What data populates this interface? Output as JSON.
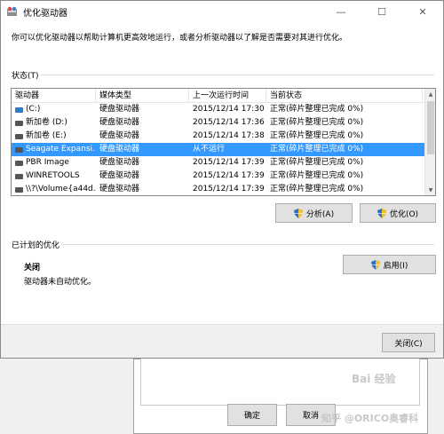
{
  "window": {
    "title": "优化驱动器",
    "controls": {
      "minimize": "—",
      "maximize": "☐",
      "close": "✕"
    }
  },
  "description": "你可以优化驱动器以帮助计算机更高效地运行，或者分析驱动器以了解是否需要对其进行优化。",
  "status_section": {
    "label": "状态(T)",
    "columns": [
      "驱动器",
      "媒体类型",
      "上一次运行时间",
      "当前状态"
    ],
    "rows": [
      {
        "drive": "(C:)",
        "media": "硬盘驱动器",
        "last_run": "2015/12/14 17:30",
        "status": "正常(碎片整理已完成 0%)",
        "icon": "system-drive-icon",
        "selected": false
      },
      {
        "drive": "新加卷 (D:)",
        "media": "硬盘驱动器",
        "last_run": "2015/12/14 17:36",
        "status": "正常(碎片整理已完成 0%)",
        "icon": "drive-icon",
        "selected": false
      },
      {
        "drive": "新加卷 (E:)",
        "media": "硬盘驱动器",
        "last_run": "2015/12/14 17:38",
        "status": "正常(碎片整理已完成 0%)",
        "icon": "drive-icon",
        "selected": false
      },
      {
        "drive": "Seagate Expansi...",
        "media": "硬盘驱动器",
        "last_run": "从不运行",
        "status": "正常(碎片整理已完成 0%)",
        "icon": "drive-icon",
        "selected": true
      },
      {
        "drive": "PBR Image",
        "media": "硬盘驱动器",
        "last_run": "2015/12/14 17:39",
        "status": "正常(碎片整理已完成 0%)",
        "icon": "drive-icon",
        "selected": false
      },
      {
        "drive": "WINRETOOLS",
        "media": "硬盘驱动器",
        "last_run": "2015/12/14 17:39",
        "status": "正常(碎片整理已完成 0%)",
        "icon": "drive-icon",
        "selected": false
      },
      {
        "drive": "\\\\?\\Volume{a44d...",
        "media": "硬盘驱动器",
        "last_run": "2015/12/14 17:39",
        "status": "正常(碎片整理已完成 0%)",
        "icon": "drive-icon",
        "selected": false
      }
    ],
    "analyze_button": "分析(A)",
    "optimize_button": "优化(O)"
  },
  "scheduled": {
    "label": "已计划的优化",
    "state": "关闭",
    "detail": "驱动器未自动优化。",
    "enable_button": "启用(I)"
  },
  "close_button": "关闭(C)",
  "background_dialog": {
    "ok_button": "确定",
    "cancel_button": "取消"
  },
  "watermarks": {
    "baidu": "Bai  经验",
    "zhihu": "知乎 @ORICO奥睿科"
  },
  "colors": {
    "selection": "#3399ff",
    "button_face": "#e1e1e1",
    "shield_blue": "#2f6fc4",
    "shield_yellow": "#f2c12e"
  }
}
